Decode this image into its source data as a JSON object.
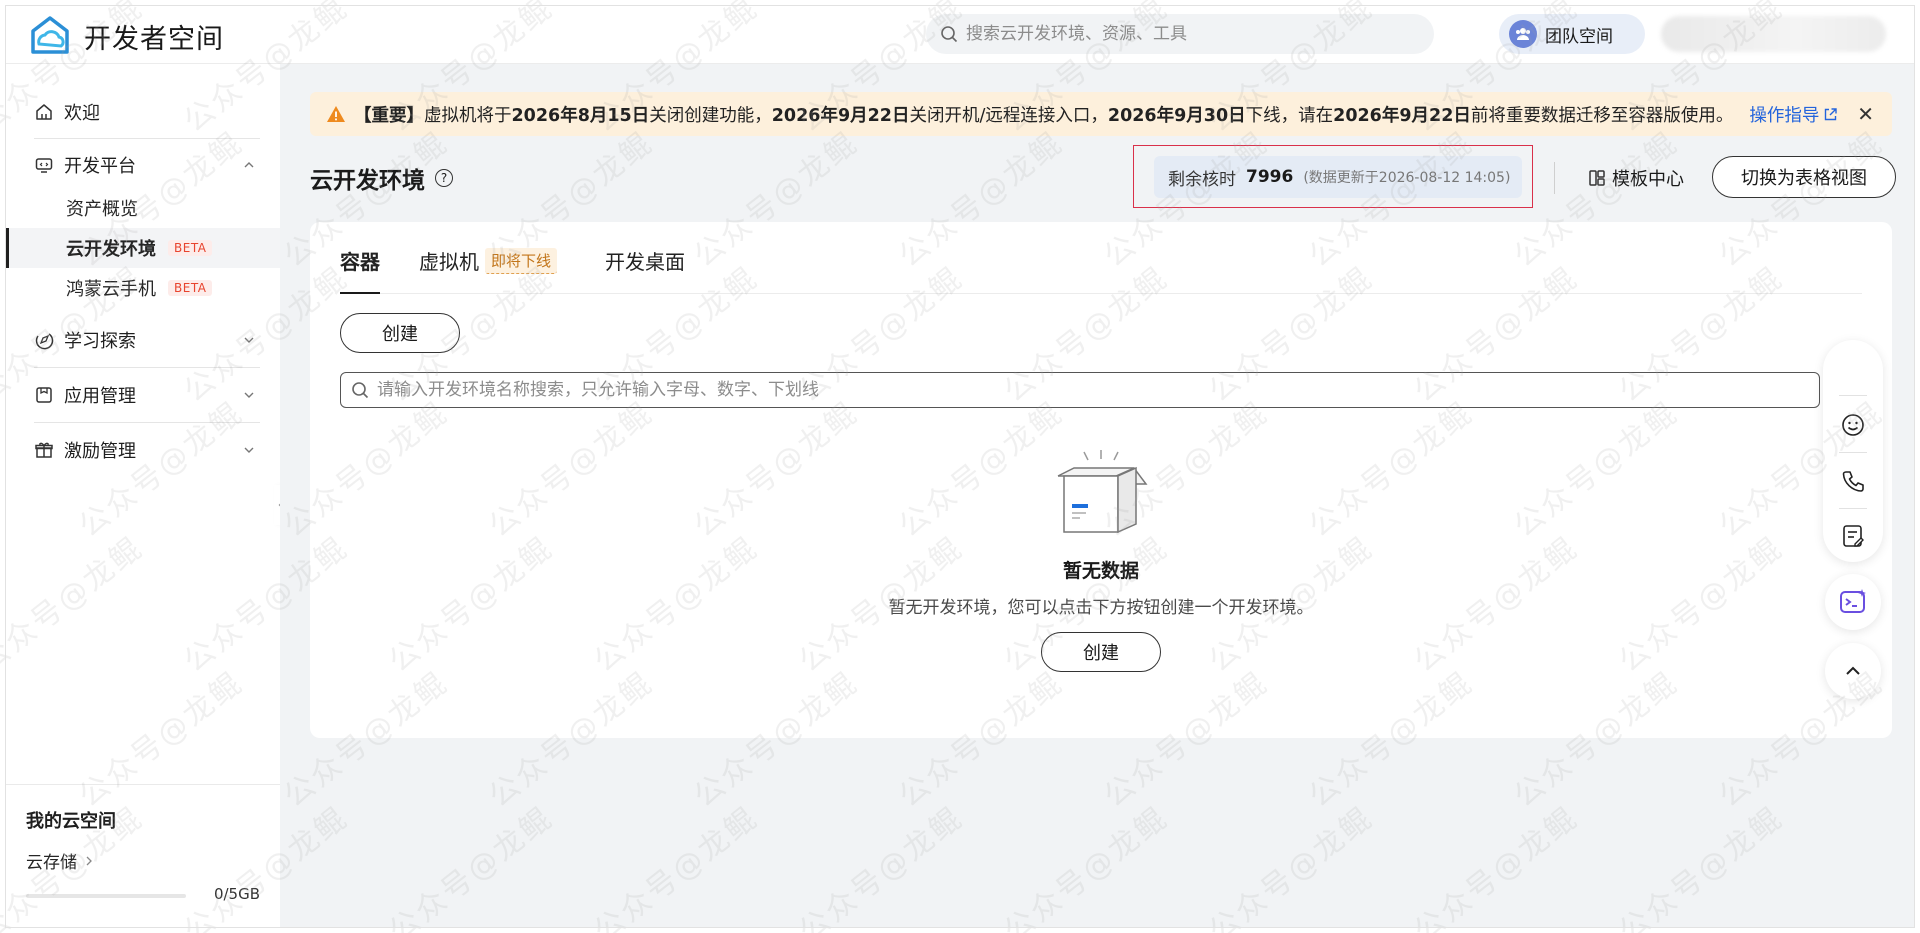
{
  "header": {
    "app_title": "开发者空间",
    "search_placeholder": "搜索云开发环境、资源、工具",
    "team_label": "团队空间"
  },
  "sidebar": {
    "welcome": "欢迎",
    "dev_platform": "开发平台",
    "asset_overview": "资产概览",
    "cloud_env": "云开发环境",
    "hongmeng_phone": "鸿蒙云手机",
    "beta": "BETA",
    "learn": "学习探索",
    "app_mgmt": "应用管理",
    "incentive": "激励管理",
    "my_cloud_title": "我的云空间",
    "cloud_storage": "云存储",
    "storage_usage": "0/5GB",
    "storage_fraction": 0
  },
  "notice": {
    "prefix": "【重要】",
    "p1": "虚拟机将于",
    "d1": "2026年8月15日",
    "p2": "关闭创建功能，",
    "d2": "2026年9月22日",
    "p3": "关闭开机/远程连接入口，",
    "d3": "2026年9月30日",
    "p4": "下线，请在",
    "d4": "2026年9月22日",
    "p5": "前将重要数据迁移至容器版使用。",
    "link": "操作指导"
  },
  "page": {
    "title": "云开发环境",
    "quota_label": "剩余核时",
    "quota_value": "7996",
    "quota_update": "(数据更新于2026-08-12 14:05)",
    "template_center": "模板中心",
    "switch_view": "切换为表格视图"
  },
  "tabs": {
    "container": "容器",
    "vm": "虚拟机",
    "vm_tag": "即将下线",
    "desktop": "开发桌面"
  },
  "content": {
    "create": "创建",
    "search_placeholder": "请输入开发环境名称搜索，只允许输入字母、数字、下划线",
    "empty_title": "暂无数据",
    "empty_desc": "暂无开发环境，您可以点击下方按钮创建一个开发环境。",
    "empty_create": "创建"
  },
  "watermark": {
    "text": "公众号@龙鲲"
  },
  "colors": {
    "accent_link": "#2364dc",
    "notice_bg": "#fdf0dc",
    "beta_red": "#e8442e",
    "highlight_border": "#d9304a"
  }
}
